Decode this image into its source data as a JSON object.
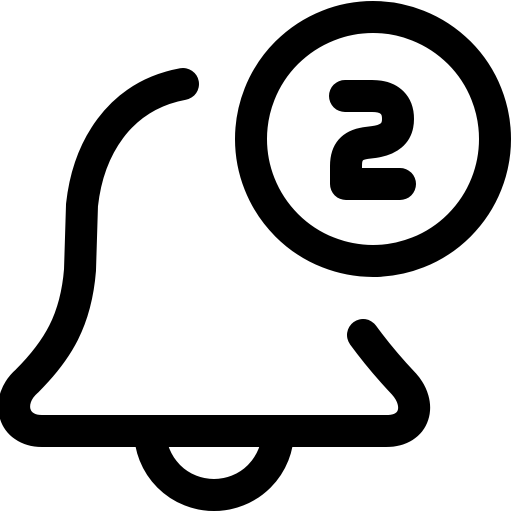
{
  "icon": {
    "name": "bell-notification-icon",
    "badge_count": 2,
    "stroke_color": "#000000",
    "background_color": "#ffffff"
  }
}
